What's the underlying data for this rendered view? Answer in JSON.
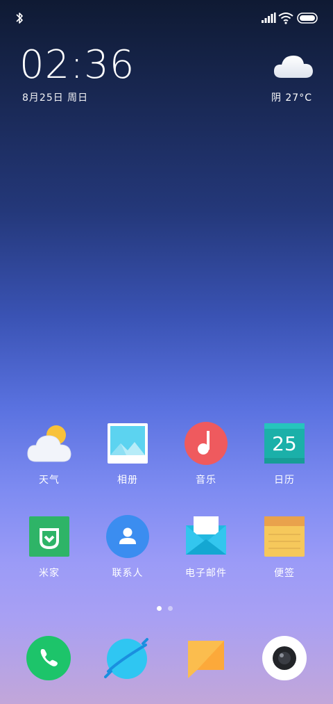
{
  "status_bar": {
    "icons": [
      "bluetooth-icon",
      "signal-icon",
      "wifi-icon",
      "battery-icon"
    ]
  },
  "clock": {
    "time": "02:36",
    "date": "8月25日 周日"
  },
  "weather_widget": {
    "icon": "cloud-icon",
    "text": "阴 27°C"
  },
  "apps": [
    {
      "label": "天气",
      "icon": "weather-icon"
    },
    {
      "label": "相册",
      "icon": "gallery-icon"
    },
    {
      "label": "音乐",
      "icon": "music-icon"
    },
    {
      "label": "日历",
      "icon": "calendar-icon",
      "badge": "25"
    },
    {
      "label": "米家",
      "icon": "mijia-icon"
    },
    {
      "label": "联系人",
      "icon": "contacts-icon"
    },
    {
      "label": "电子邮件",
      "icon": "email-icon"
    },
    {
      "label": "便签",
      "icon": "notes-icon"
    }
  ],
  "page_indicator": {
    "pages": 2,
    "current": 1
  },
  "dock": [
    {
      "icon": "phone-icon"
    },
    {
      "icon": "browser-icon"
    },
    {
      "icon": "messages-icon"
    },
    {
      "icon": "camera-icon"
    }
  ],
  "colors": {
    "music": "#ef5a5e",
    "calendar": "#1bb0a9",
    "mijia": "#2eb467",
    "contacts": "#3b8df0",
    "notes": "#f6c85b",
    "phone": "#1dc46a",
    "browser": "#2fc6f2",
    "messages": "#fbbd4e"
  }
}
